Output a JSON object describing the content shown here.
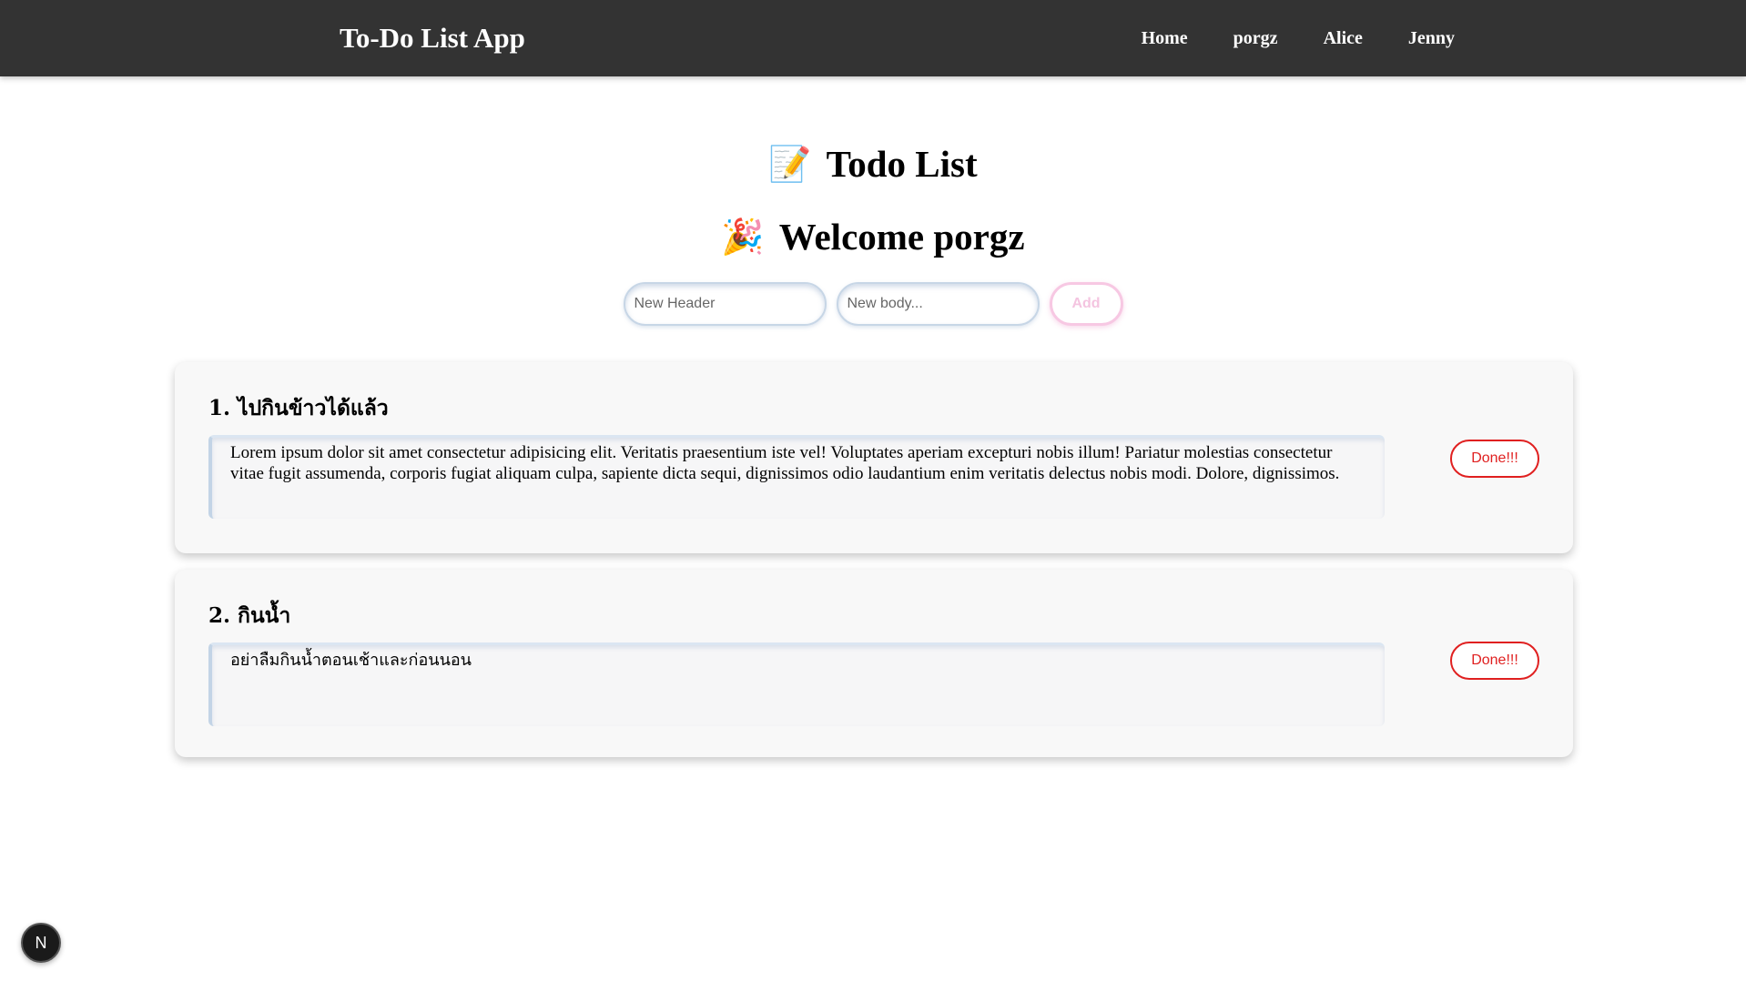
{
  "navbar": {
    "brand": "To-Do List App",
    "links": [
      "Home",
      "porgz",
      "Alice",
      "Jenny"
    ],
    "background": "#333333"
  },
  "page": {
    "title_icon": "memo-emoji",
    "title_emoji": "📝",
    "title": "Todo List",
    "welcome_icon": "party-popper-emoji",
    "welcome_emoji": "🎉",
    "welcome": "Welcome porgz"
  },
  "form": {
    "header_placeholder": "New Header",
    "body_placeholder": "New body...",
    "add_label": "Add",
    "add_color": "#f7c8e3"
  },
  "todos": [
    {
      "header": "1. ไปกินข้าวได้แล้ว",
      "body": "Lorem ipsum dolor sit amet consectetur adipisicing elit. Veritatis praesentium iste vel! Voluptates aperiam excepturi nobis illum! Pariatur molestias consectetur vitae fugit assumenda, corporis fugiat aliquam culpa, sapiente dicta sequi, dignissimos odio laudantium enim veritatis delectus nobis modi. Dolore, dignissimos.",
      "done_label": "Done!!!"
    },
    {
      "header": "2. กินน้ำ",
      "body": "อย่าลืมกินน้ำตอนเช้าและก่อนนอน",
      "done_label": "Done!!!"
    }
  ],
  "done_color": "#e02020",
  "dev_badge": "N"
}
